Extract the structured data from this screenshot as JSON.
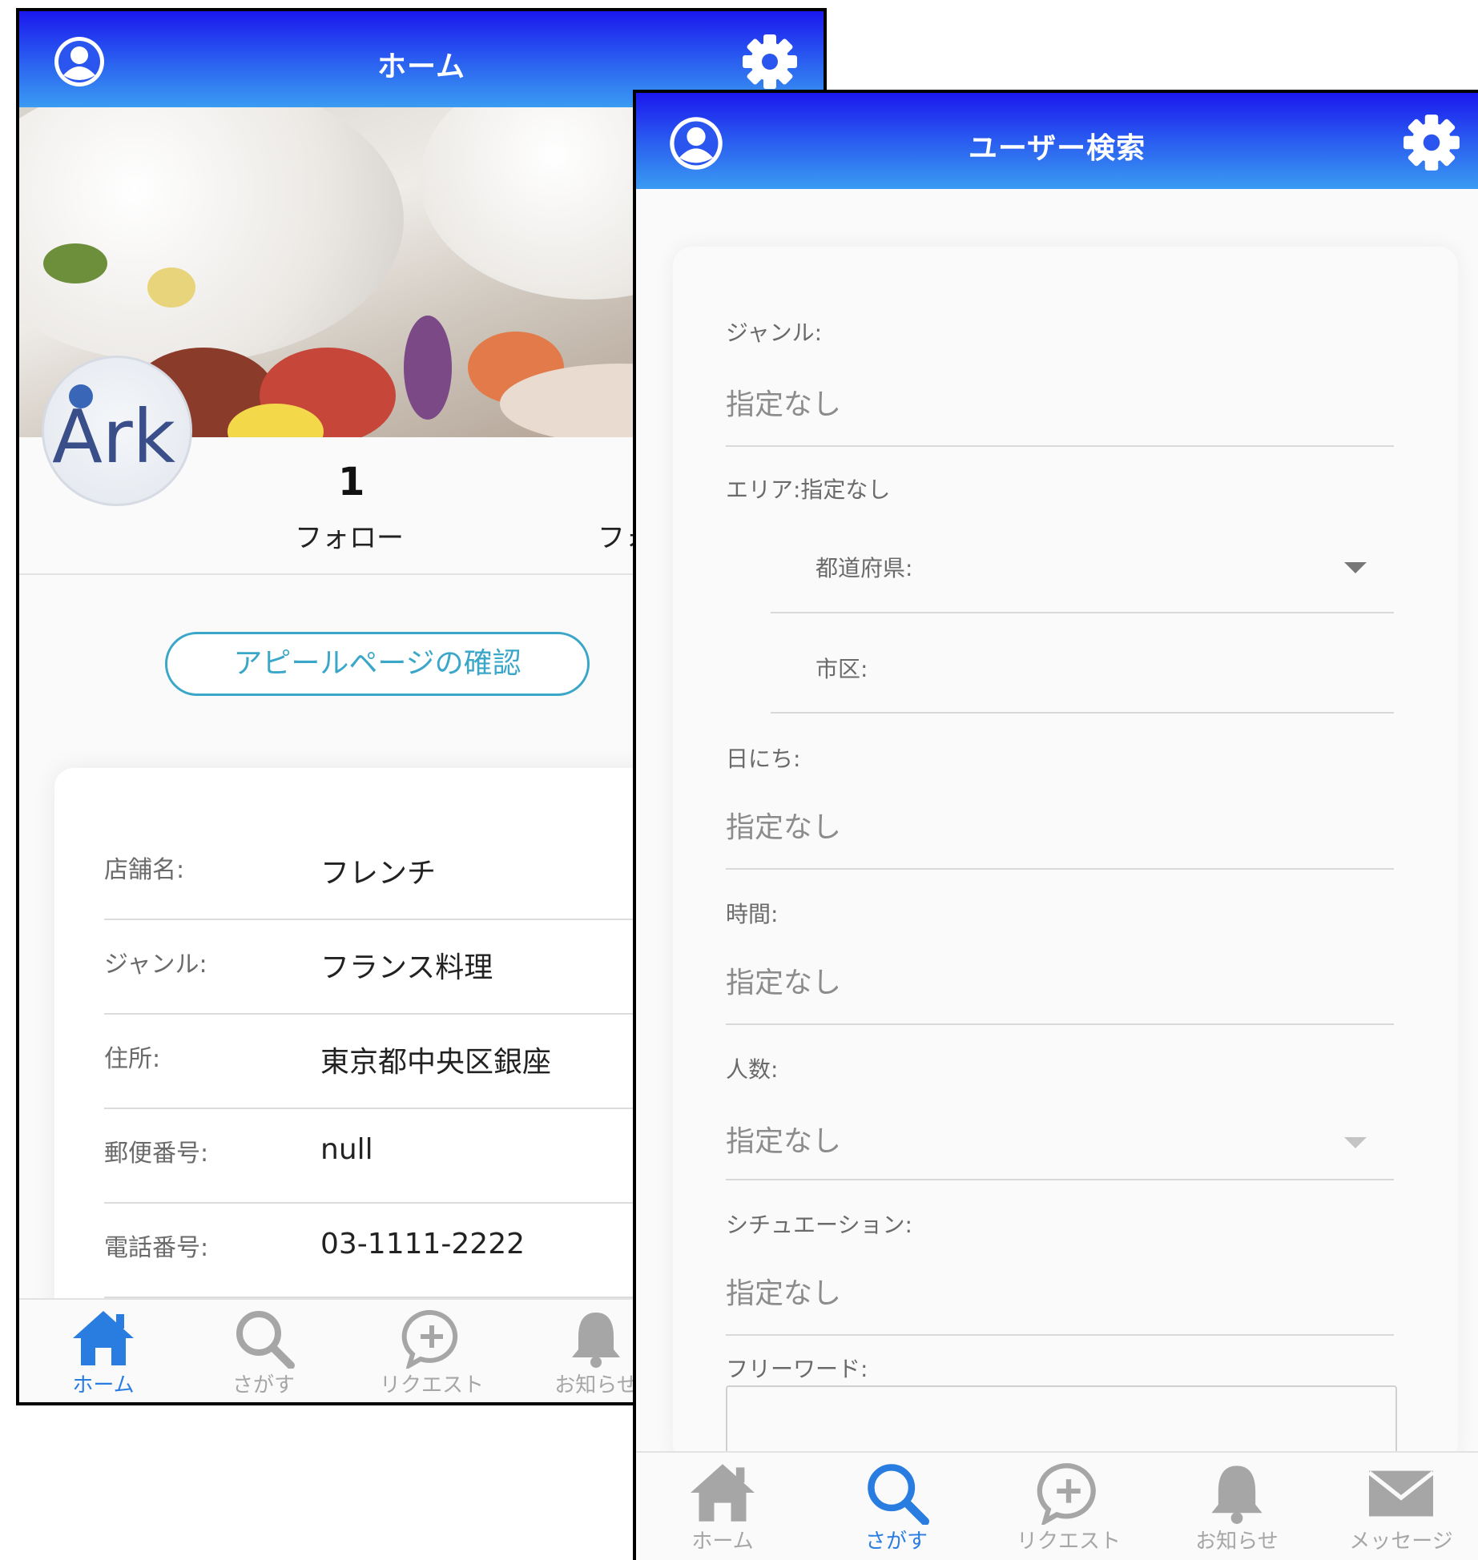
{
  "home": {
    "title": "ホーム",
    "follow_count": "1",
    "follow_label": "フォロー",
    "follower_label_partial": "フォ",
    "appeal_button": "アピールページの確認",
    "info": [
      {
        "label": "店舗名:",
        "value": "フレンチ"
      },
      {
        "label": "ジャンル:",
        "value": "フランス料理"
      },
      {
        "label": "住所:",
        "value": "東京都中央区銀座"
      },
      {
        "label": "郵便番号:",
        "value": "null"
      },
      {
        "label": "電話番号:",
        "value": "03-1111-2222"
      }
    ],
    "tabs": [
      "ホーム",
      "さがす",
      "リクエスト",
      "お知らせ"
    ]
  },
  "search": {
    "title": "ユーザー検索",
    "genre_label": "ジャンル:",
    "genre_value": "指定なし",
    "area_label": "エリア:指定なし",
    "prefecture_label": "都道府県:",
    "city_label": "市区:",
    "date_label": "日にち:",
    "date_value": "指定なし",
    "time_label": "時間:",
    "time_value": "指定なし",
    "people_label": "人数:",
    "people_value": "指定なし",
    "situation_label": "シチュエーション:",
    "situation_value": "指定なし",
    "freeword_label": "フリーワード:",
    "tabs": [
      "ホーム",
      "さがす",
      "リクエスト",
      "お知らせ",
      "メッセージ"
    ]
  },
  "colors": {
    "header_top": "#1b18ee",
    "header_bottom": "#3a9bf2",
    "active_tab": "#2a7de0",
    "appeal_button": "#3aa7c8"
  },
  "icons": [
    "user-icon",
    "gear-icon",
    "home-icon",
    "search-icon",
    "request-icon",
    "bell-icon",
    "mail-icon"
  ]
}
